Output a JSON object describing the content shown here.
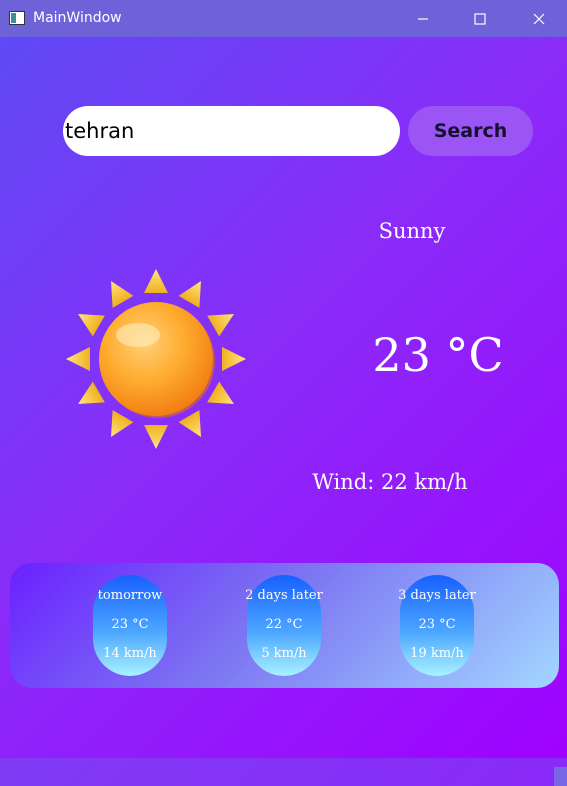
{
  "window": {
    "title": "MainWindow"
  },
  "search": {
    "value": "tehran",
    "button_label": "Search"
  },
  "current": {
    "condition": "Sunny",
    "temperature": "23 °C",
    "wind": "Wind: 22 km/h",
    "icon": "sun-icon"
  },
  "forecast": [
    {
      "day": "tomorrow",
      "temp": "23 °C",
      "wind": "14 km/h"
    },
    {
      "day": "2 days later",
      "temp": "22 °C",
      "wind": "5 km/h"
    },
    {
      "day": "3 days later",
      "temp": "23 °C",
      "wind": "19 km/h"
    }
  ],
  "colors": {
    "background_start": "#5c4cf5",
    "background_end": "#a000ff",
    "title_bar": "#6e62d8",
    "search_button": "#9b55f4",
    "forecast_card_top": "#1860ff",
    "forecast_card_bottom": "#a8f2ff"
  }
}
